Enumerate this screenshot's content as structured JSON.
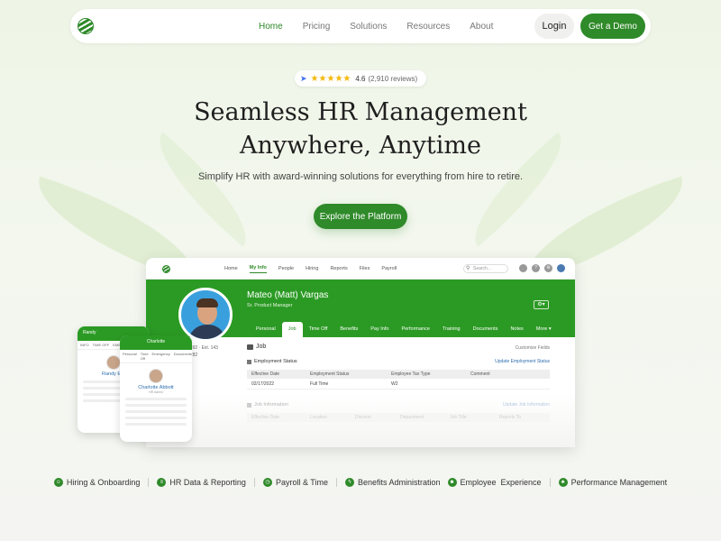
{
  "nav": {
    "links": [
      "Home",
      "Pricing",
      "Solutions",
      "Resources",
      "About"
    ],
    "login": "Login",
    "demo": "Get a Demo"
  },
  "rating": {
    "stars": "★★★★★",
    "score": "4.6",
    "reviews": "(2,910 reviews)"
  },
  "hero": {
    "title_line1": "Seamless HR Management",
    "title_line2": "Anywhere, Anytime",
    "subtitle": "Simplify HR with award-winning solutions for everything from hire to retire.",
    "cta": "Explore the Platform"
  },
  "app": {
    "nav": [
      "Home",
      "My Info",
      "People",
      "Hiring",
      "Reports",
      "Files",
      "Payroll"
    ],
    "search_placeholder": "Search...",
    "employee_name": "Mateo (Matt) Vargas",
    "employee_title": "Sr. Product Manager",
    "tabs": [
      "Personal",
      "Job",
      "Time Off",
      "Benefits",
      "Pay Info",
      "Performance",
      "Training",
      "Documents",
      "Notes",
      "More ▾"
    ],
    "side_lines": [
      "801-3892 · Ext. 143",
      "987-3782"
    ],
    "section_title": "Job",
    "customize": "Customize Fields",
    "employment_status": "Employment Status",
    "update_employment": "Update Employment Status",
    "table_headers": [
      "Effective Date",
      "Employment Status",
      "Employee Tax Type",
      "Comment"
    ],
    "table_row": [
      "02/17/2022",
      "Full Time",
      "W2",
      ""
    ],
    "job_information": "Job Information",
    "update_job": "Update Job Information",
    "job_headers": [
      "Effective Date",
      "Location",
      "Division",
      "Department",
      "Job Title",
      "Reports To"
    ]
  },
  "phones": {
    "p1_header": "Randy",
    "p1_tabs": [
      "INFO",
      "TIME OFF",
      "EMERG"
    ],
    "p1_name": "Randy Ern",
    "p2_header": "Charlotte",
    "p2_tabs": [
      "Personal",
      "Time Off",
      "Emergency",
      "Documents"
    ],
    "p2_name": "Charlotte Abbott",
    "p2_sub": "HR Admin"
  },
  "features": [
    "Hiring & Onboarding",
    "HR Data & Reporting",
    "Payroll & Time",
    "Benefits Administration",
    "Employee  Experience",
    "Performance Management"
  ],
  "colors": {
    "brand": "#2f8a2a",
    "banner": "#2b9a24",
    "link": "#2e6fb0"
  }
}
